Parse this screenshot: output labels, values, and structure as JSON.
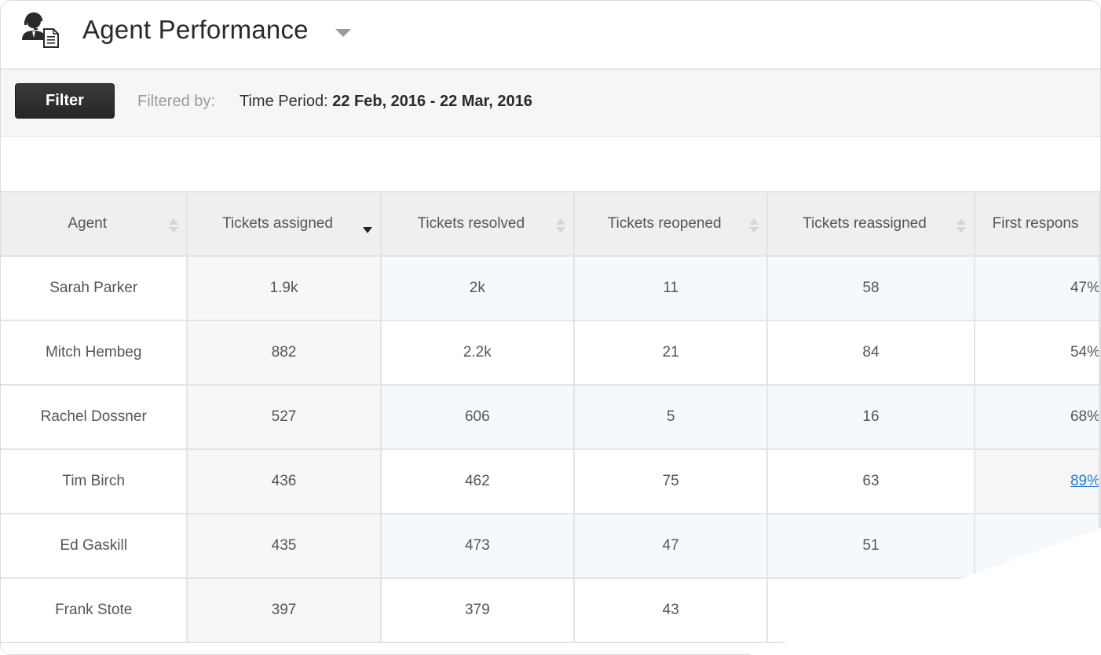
{
  "header": {
    "icon": "agent-report-icon",
    "title": "Agent Performance",
    "title_dropdown_icon": "caret-down-icon"
  },
  "filterbar": {
    "filter_button": "Filter",
    "filtered_by_label": "Filtered by:",
    "period_label": "Time Period:",
    "period_value": "22 Feb, 2016 - 22 Mar, 2016"
  },
  "table": {
    "columns": [
      {
        "label": "Agent",
        "sort": "none"
      },
      {
        "label": "Tickets assigned",
        "sort": "descending"
      },
      {
        "label": "Tickets resolved",
        "sort": "none"
      },
      {
        "label": "Tickets reopened",
        "sort": "none"
      },
      {
        "label": "Tickets reassigned",
        "sort": "none"
      },
      {
        "label": "First respons",
        "sort": "none"
      }
    ],
    "rows": [
      {
        "agent": "Sarah Parker",
        "assigned": "1.9k",
        "resolved": "2k",
        "reopened": "11",
        "reassigned": "58",
        "first_response": "47%"
      },
      {
        "agent": "Mitch Hembeg",
        "assigned": "882",
        "resolved": "2.2k",
        "reopened": "21",
        "reassigned": "84",
        "first_response": "54%"
      },
      {
        "agent": "Rachel Dossner",
        "assigned": "527",
        "resolved": "606",
        "reopened": "5",
        "reassigned": "16",
        "first_response": "68%"
      },
      {
        "agent": "Tim Birch",
        "assigned": "436",
        "resolved": "462",
        "reopened": "75",
        "reassigned": "63",
        "first_response": "89%"
      },
      {
        "agent": "Ed Gaskill",
        "assigned": "435",
        "resolved": "473",
        "reopened": "47",
        "reassigned": "51",
        "first_response": ""
      },
      {
        "agent": "Frank Stote",
        "assigned": "397",
        "resolved": "379",
        "reopened": "43",
        "reassigned": "",
        "first_response": ""
      }
    ],
    "hovered_link_cell": {
      "row": 3,
      "column": "first_response",
      "color": "#2a7bd6"
    }
  },
  "colors": {
    "header_bg": "#efefef",
    "sorted_col_bg": "#f7f7f7",
    "odd_row_bg": "#f6f9fc",
    "filter_button_bg": "#2e2e2e",
    "link": "#2a7bd6"
  }
}
